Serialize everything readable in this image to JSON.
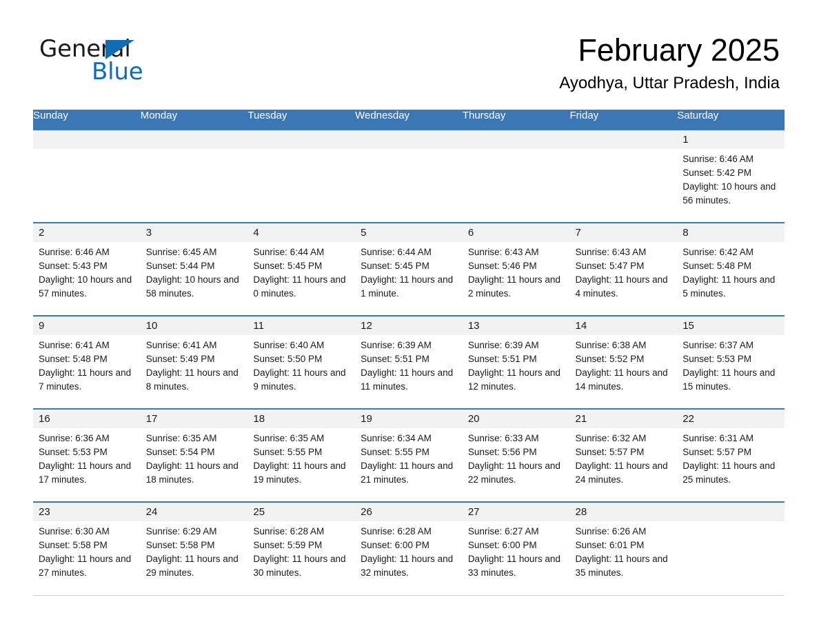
{
  "brand": {
    "name_part1": "General",
    "name_part2": "Blue",
    "accent_color": "#0f6cb6"
  },
  "header": {
    "title": "February 2025",
    "subtitle": "Ayodhya, Uttar Pradesh, India",
    "header_bg_color": "#3b77b5",
    "daynum_bg_color": "#f2f2f2"
  },
  "weekday_headers": [
    "Sunday",
    "Monday",
    "Tuesday",
    "Wednesday",
    "Thursday",
    "Friday",
    "Saturday"
  ],
  "weeks": [
    [
      {
        "day": "",
        "empty": true
      },
      {
        "day": "",
        "empty": true
      },
      {
        "day": "",
        "empty": true
      },
      {
        "day": "",
        "empty": true
      },
      {
        "day": "",
        "empty": true
      },
      {
        "day": "",
        "empty": true
      },
      {
        "day": "1",
        "sunrise": "Sunrise: 6:46 AM",
        "sunset": "Sunset: 5:42 PM",
        "daylight": "Daylight: 10 hours and 56 minutes."
      }
    ],
    [
      {
        "day": "2",
        "sunrise": "Sunrise: 6:46 AM",
        "sunset": "Sunset: 5:43 PM",
        "daylight": "Daylight: 10 hours and 57 minutes."
      },
      {
        "day": "3",
        "sunrise": "Sunrise: 6:45 AM",
        "sunset": "Sunset: 5:44 PM",
        "daylight": "Daylight: 10 hours and 58 minutes."
      },
      {
        "day": "4",
        "sunrise": "Sunrise: 6:44 AM",
        "sunset": "Sunset: 5:45 PM",
        "daylight": "Daylight: 11 hours and 0 minutes."
      },
      {
        "day": "5",
        "sunrise": "Sunrise: 6:44 AM",
        "sunset": "Sunset: 5:45 PM",
        "daylight": "Daylight: 11 hours and 1 minute."
      },
      {
        "day": "6",
        "sunrise": "Sunrise: 6:43 AM",
        "sunset": "Sunset: 5:46 PM",
        "daylight": "Daylight: 11 hours and 2 minutes."
      },
      {
        "day": "7",
        "sunrise": "Sunrise: 6:43 AM",
        "sunset": "Sunset: 5:47 PM",
        "daylight": "Daylight: 11 hours and 4 minutes."
      },
      {
        "day": "8",
        "sunrise": "Sunrise: 6:42 AM",
        "sunset": "Sunset: 5:48 PM",
        "daylight": "Daylight: 11 hours and 5 minutes."
      }
    ],
    [
      {
        "day": "9",
        "sunrise": "Sunrise: 6:41 AM",
        "sunset": "Sunset: 5:48 PM",
        "daylight": "Daylight: 11 hours and 7 minutes."
      },
      {
        "day": "10",
        "sunrise": "Sunrise: 6:41 AM",
        "sunset": "Sunset: 5:49 PM",
        "daylight": "Daylight: 11 hours and 8 minutes."
      },
      {
        "day": "11",
        "sunrise": "Sunrise: 6:40 AM",
        "sunset": "Sunset: 5:50 PM",
        "daylight": "Daylight: 11 hours and 9 minutes."
      },
      {
        "day": "12",
        "sunrise": "Sunrise: 6:39 AM",
        "sunset": "Sunset: 5:51 PM",
        "daylight": "Daylight: 11 hours and 11 minutes."
      },
      {
        "day": "13",
        "sunrise": "Sunrise: 6:39 AM",
        "sunset": "Sunset: 5:51 PM",
        "daylight": "Daylight: 11 hours and 12 minutes."
      },
      {
        "day": "14",
        "sunrise": "Sunrise: 6:38 AM",
        "sunset": "Sunset: 5:52 PM",
        "daylight": "Daylight: 11 hours and 14 minutes."
      },
      {
        "day": "15",
        "sunrise": "Sunrise: 6:37 AM",
        "sunset": "Sunset: 5:53 PM",
        "daylight": "Daylight: 11 hours and 15 minutes."
      }
    ],
    [
      {
        "day": "16",
        "sunrise": "Sunrise: 6:36 AM",
        "sunset": "Sunset: 5:53 PM",
        "daylight": "Daylight: 11 hours and 17 minutes."
      },
      {
        "day": "17",
        "sunrise": "Sunrise: 6:35 AM",
        "sunset": "Sunset: 5:54 PM",
        "daylight": "Daylight: 11 hours and 18 minutes."
      },
      {
        "day": "18",
        "sunrise": "Sunrise: 6:35 AM",
        "sunset": "Sunset: 5:55 PM",
        "daylight": "Daylight: 11 hours and 19 minutes."
      },
      {
        "day": "19",
        "sunrise": "Sunrise: 6:34 AM",
        "sunset": "Sunset: 5:55 PM",
        "daylight": "Daylight: 11 hours and 21 minutes."
      },
      {
        "day": "20",
        "sunrise": "Sunrise: 6:33 AM",
        "sunset": "Sunset: 5:56 PM",
        "daylight": "Daylight: 11 hours and 22 minutes."
      },
      {
        "day": "21",
        "sunrise": "Sunrise: 6:32 AM",
        "sunset": "Sunset: 5:57 PM",
        "daylight": "Daylight: 11 hours and 24 minutes."
      },
      {
        "day": "22",
        "sunrise": "Sunrise: 6:31 AM",
        "sunset": "Sunset: 5:57 PM",
        "daylight": "Daylight: 11 hours and 25 minutes."
      }
    ],
    [
      {
        "day": "23",
        "sunrise": "Sunrise: 6:30 AM",
        "sunset": "Sunset: 5:58 PM",
        "daylight": "Daylight: 11 hours and 27 minutes."
      },
      {
        "day": "24",
        "sunrise": "Sunrise: 6:29 AM",
        "sunset": "Sunset: 5:58 PM",
        "daylight": "Daylight: 11 hours and 29 minutes."
      },
      {
        "day": "25",
        "sunrise": "Sunrise: 6:28 AM",
        "sunset": "Sunset: 5:59 PM",
        "daylight": "Daylight: 11 hours and 30 minutes."
      },
      {
        "day": "26",
        "sunrise": "Sunrise: 6:28 AM",
        "sunset": "Sunset: 6:00 PM",
        "daylight": "Daylight: 11 hours and 32 minutes."
      },
      {
        "day": "27",
        "sunrise": "Sunrise: 6:27 AM",
        "sunset": "Sunset: 6:00 PM",
        "daylight": "Daylight: 11 hours and 33 minutes."
      },
      {
        "day": "28",
        "sunrise": "Sunrise: 6:26 AM",
        "sunset": "Sunset: 6:01 PM",
        "daylight": "Daylight: 11 hours and 35 minutes."
      },
      {
        "day": "",
        "empty": true
      }
    ]
  ]
}
